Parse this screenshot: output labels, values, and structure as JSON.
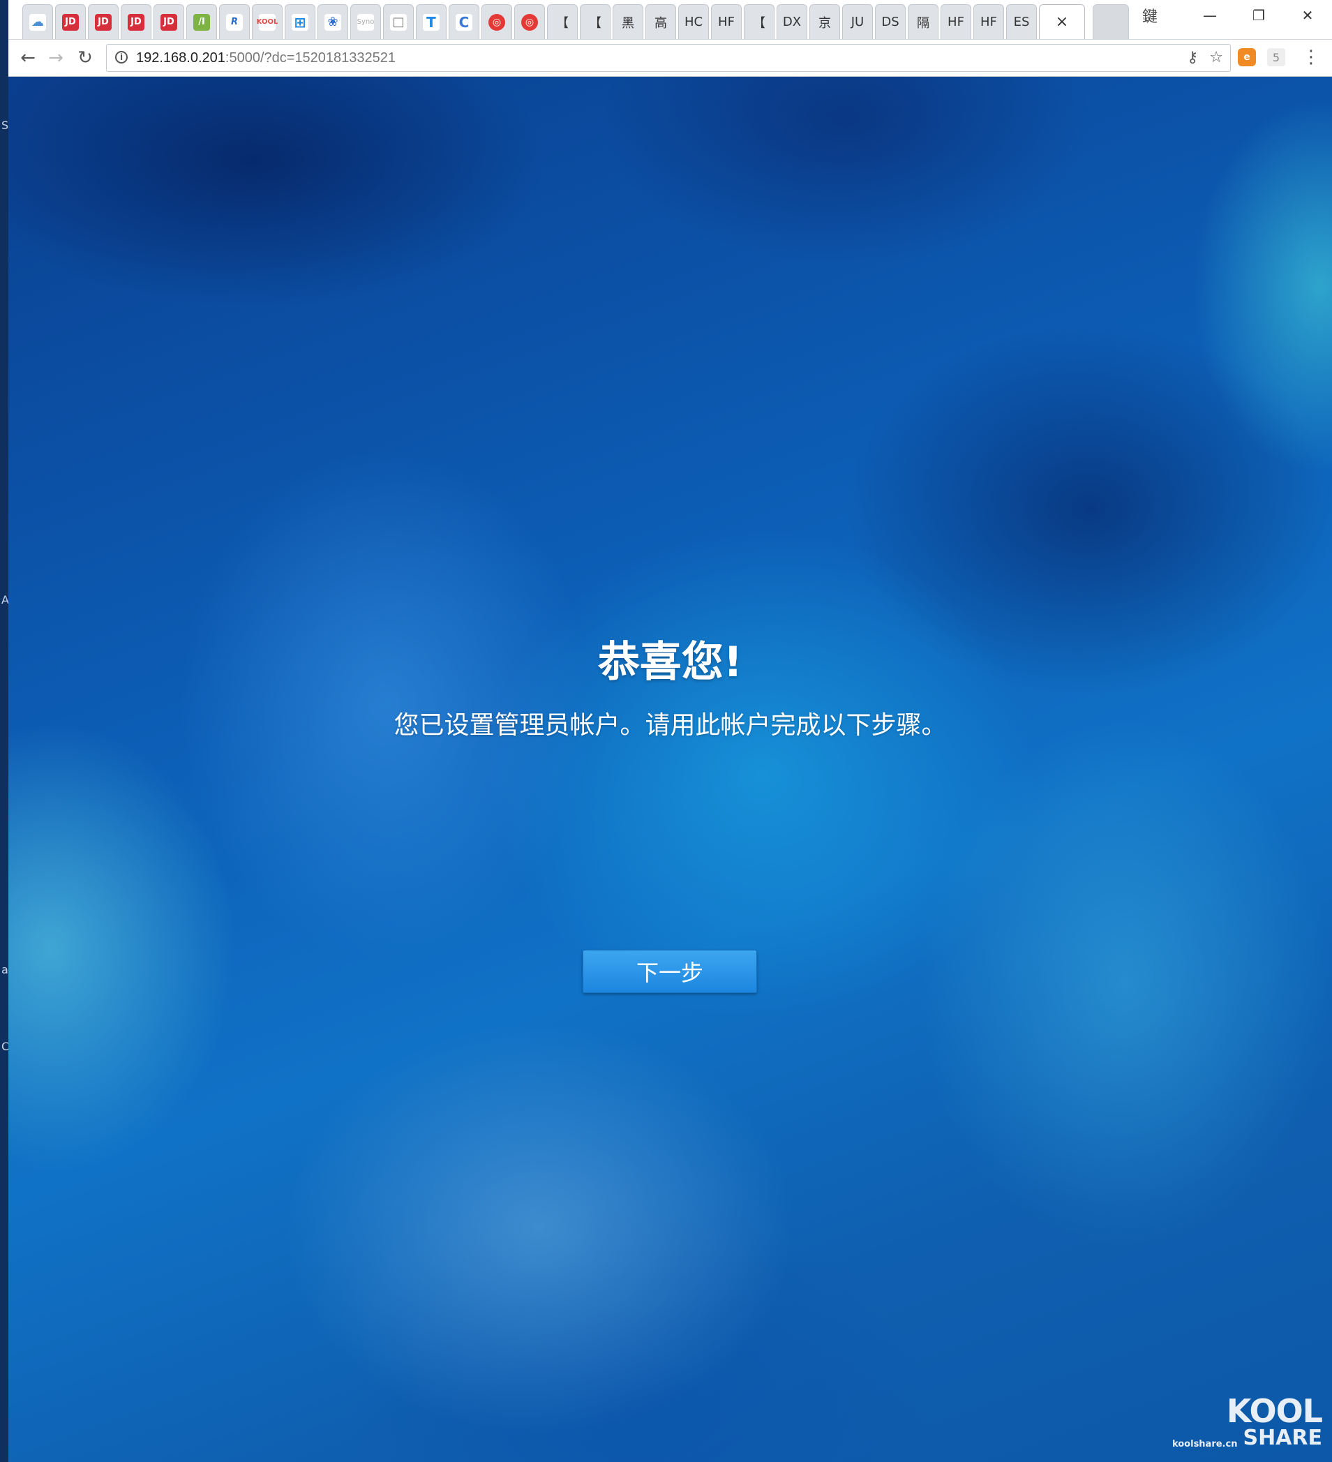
{
  "browser": {
    "tabs": [
      {
        "icon": "cloud-icon",
        "glyph": "☁",
        "text": ""
      },
      {
        "icon": "jd-icon",
        "glyph": "JD",
        "text": ""
      },
      {
        "icon": "jd-icon",
        "glyph": "JD",
        "text": ""
      },
      {
        "icon": "jd-icon",
        "glyph": "JD",
        "text": ""
      },
      {
        "icon": "jd-icon",
        "glyph": "JD",
        "text": ""
      },
      {
        "icon": "green-n-icon",
        "glyph": "/I",
        "text": ""
      },
      {
        "icon": "r-icon",
        "glyph": "R",
        "text": ""
      },
      {
        "icon": "koolshare-icon",
        "glyph": "KOOL",
        "text": ""
      },
      {
        "icon": "windows-icon",
        "glyph": "⊞",
        "text": ""
      },
      {
        "icon": "paw-icon",
        "glyph": "❀",
        "text": ""
      },
      {
        "icon": "synology-icon",
        "glyph": "Syno",
        "text": ""
      },
      {
        "icon": "document-icon",
        "glyph": "□",
        "text": ""
      },
      {
        "icon": "t-icon",
        "glyph": "T",
        "text": ""
      },
      {
        "icon": "c-icon",
        "glyph": "C",
        "text": ""
      },
      {
        "icon": "red-swirl-icon",
        "glyph": "◎",
        "text": ""
      },
      {
        "icon": "red-swirl-icon",
        "glyph": "◎",
        "text": ""
      },
      {
        "icon": "",
        "glyph": "",
        "text": "【"
      },
      {
        "icon": "",
        "glyph": "",
        "text": "【"
      },
      {
        "icon": "",
        "glyph": "",
        "text": "黑"
      },
      {
        "icon": "",
        "glyph": "",
        "text": "高"
      },
      {
        "icon": "",
        "glyph": "",
        "text": "HC"
      },
      {
        "icon": "",
        "glyph": "",
        "text": "HF"
      },
      {
        "icon": "",
        "glyph": "",
        "text": "【"
      },
      {
        "icon": "",
        "glyph": "",
        "text": "DX"
      },
      {
        "icon": "",
        "glyph": "",
        "text": "京"
      },
      {
        "icon": "",
        "glyph": "",
        "text": "JU"
      },
      {
        "icon": "",
        "glyph": "",
        "text": "DS"
      },
      {
        "icon": "",
        "glyph": "",
        "text": "隔"
      },
      {
        "icon": "",
        "glyph": "",
        "text": "HF"
      },
      {
        "icon": "",
        "glyph": "",
        "text": "HF"
      },
      {
        "icon": "",
        "glyph": "",
        "text": "ES"
      }
    ],
    "active_tab_close": "×",
    "ime_indicator": "鍵",
    "window_controls": {
      "minimize": "—",
      "restore": "❐",
      "close": "✕"
    },
    "address": {
      "host": "192.168.0.201",
      "rest": ":5000/?dc=1520181332521"
    },
    "extension_badge": "5"
  },
  "page": {
    "headline": "恭喜您!",
    "message": "您已设置管理员帐户。请用此帐户完成以下步骤。",
    "next_button": "下一步"
  },
  "watermark": {
    "brand_top": "KOOL",
    "site": "koolshare.cn",
    "brand_bottom": "SHARE"
  },
  "colors": {
    "button": "#2590e6",
    "background": "#0c5bb3"
  }
}
